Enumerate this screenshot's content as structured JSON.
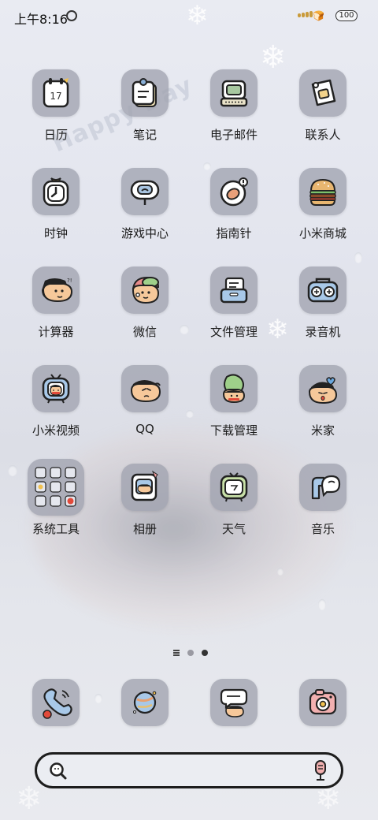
{
  "status_bar": {
    "time": "上午8:16",
    "battery": "100"
  },
  "wallpaper": {
    "watermark": "Happy Day"
  },
  "apps": [
    {
      "label": "日历",
      "icon": "calendar-icon",
      "date_text": "17"
    },
    {
      "label": "笔记",
      "icon": "notes-icon"
    },
    {
      "label": "电子邮件",
      "icon": "computer-mail-icon"
    },
    {
      "label": "联系人",
      "icon": "contacts-icon"
    },
    {
      "label": "时钟",
      "icon": "clock-icon"
    },
    {
      "label": "游戏中心",
      "icon": "game-center-icon"
    },
    {
      "label": "指南针",
      "icon": "compass-icon"
    },
    {
      "label": "小米商城",
      "icon": "burger-icon"
    },
    {
      "label": "计算器",
      "icon": "calculator-icon"
    },
    {
      "label": "微信",
      "icon": "wechat-icon"
    },
    {
      "label": "文件管理",
      "icon": "file-manager-icon"
    },
    {
      "label": "录音机",
      "icon": "recorder-icon"
    },
    {
      "label": "小米视频",
      "icon": "tv-video-icon"
    },
    {
      "label": "QQ",
      "icon": "qq-icon"
    },
    {
      "label": "下载管理",
      "icon": "download-icon"
    },
    {
      "label": "米家",
      "icon": "mijia-icon"
    },
    {
      "label": "系统工具",
      "icon": "folder-tools-icon"
    },
    {
      "label": "相册",
      "icon": "gallery-icon"
    },
    {
      "label": "天气",
      "icon": "weather-icon"
    },
    {
      "label": "音乐",
      "icon": "music-icon"
    }
  ],
  "dock": [
    {
      "icon": "phone-icon"
    },
    {
      "icon": "browser-planet-icon"
    },
    {
      "icon": "messages-icon"
    },
    {
      "icon": "camera-icon"
    }
  ],
  "page_indicator": {
    "pages": 2,
    "active": 2
  },
  "colors": {
    "icon_bg": "#a0a3af",
    "skin": "#f6c89a",
    "hair": "#2a2a2a",
    "accent_red": "#d8483e"
  }
}
